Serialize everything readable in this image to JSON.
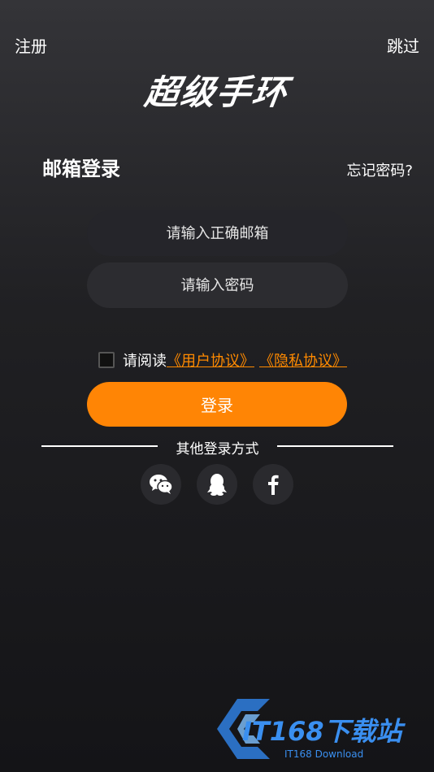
{
  "header": {
    "register_label": "注册",
    "skip_label": "跳过",
    "app_logo_text": "超级手环"
  },
  "login": {
    "title": "邮箱登录",
    "forgot_label": "忘记密码?",
    "email_placeholder": "请输入正确邮箱",
    "password_placeholder": "请输入密码",
    "agree_prefix": "请阅读",
    "user_agreement": "《用户协议》",
    "privacy_policy": "《隐私协议》",
    "login_button": "登录",
    "other_methods": "其他登录方式"
  },
  "social": {
    "wechat_icon": "wechat-icon",
    "qq_icon": "qq-icon",
    "facebook_icon": "facebook-icon"
  },
  "watermark": {
    "text": "IT168下载站",
    "subtitle": "IT168 Download"
  },
  "colors": {
    "accent": "#ff8505",
    "link": "#ff8a00",
    "background_top": "#343438",
    "background_bottom": "#141417"
  }
}
